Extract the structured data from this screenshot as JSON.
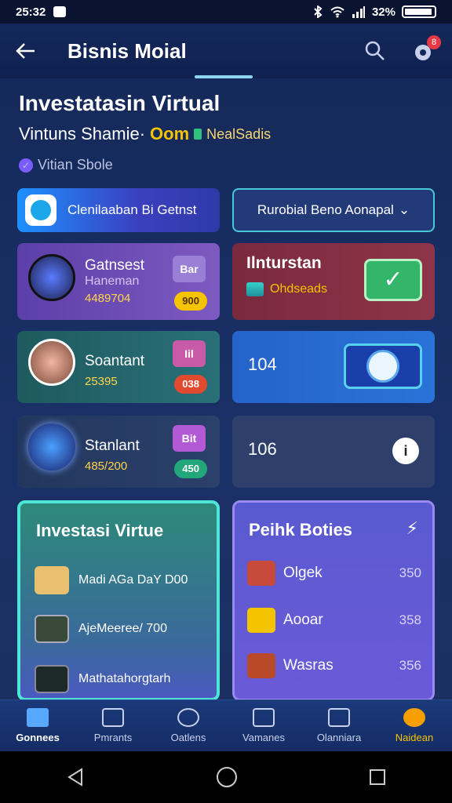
{
  "status": {
    "time": "25:32",
    "battery": "32%"
  },
  "appbar": {
    "title": "Bisnis Moial"
  },
  "header": {
    "title": "Investatasin Virtual",
    "subtitle": "Vintuns Shamie·",
    "om": "Oom",
    "new_label": "NealSadis",
    "verified": "Vitian Sbole"
  },
  "pills": {
    "left": "Clenilaaban Bi Getnst",
    "right": "Rurobial Beno Aonapal"
  },
  "cards": {
    "c1": {
      "name": "Gatnsest",
      "sub": "Haneman",
      "num": "4489704",
      "tag": "Bar",
      "chip": "900"
    },
    "c2": {
      "title": "Ilnturstan",
      "sub": "Ohdseads"
    },
    "c3": {
      "name": "Soantant",
      "num": "25395",
      "tag": "Iil",
      "chip": "038"
    },
    "c4": {
      "value": "104"
    },
    "c5": {
      "name": "Stanlant",
      "num": "485/200",
      "tag": "Bit",
      "chip": "450"
    },
    "c6": {
      "value": "106"
    }
  },
  "panel_left": {
    "title": "Investasi Virtue",
    "items": [
      {
        "label": "Madi AGa DaY D00"
      },
      {
        "label": "AjeMeeree/ 700"
      },
      {
        "label": "Mathatahorgtarh"
      }
    ]
  },
  "panel_right": {
    "title": "Peihk Boties",
    "items": [
      {
        "label": "Olgek",
        "value": "350"
      },
      {
        "label": "Aooar",
        "value": "358"
      },
      {
        "label": "Wasras",
        "value": "356"
      }
    ]
  },
  "bottom_nav": [
    {
      "label": "Gonnees"
    },
    {
      "label": "Pmrants"
    },
    {
      "label": "Oatlens"
    },
    {
      "label": "Vamanes"
    },
    {
      "label": "Olanniara"
    },
    {
      "label": "Naidean"
    }
  ]
}
